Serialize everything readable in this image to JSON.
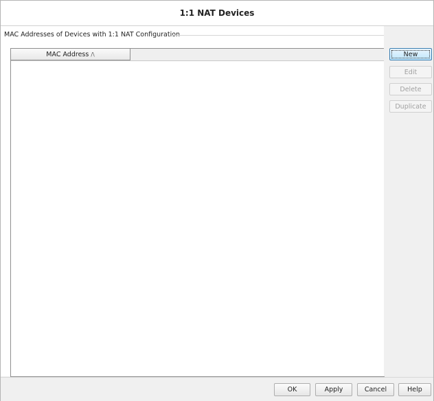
{
  "window": {
    "title": "1:1 NAT Devices"
  },
  "group": {
    "legend": "MAC Addresses of Devices with 1:1 NAT Configuration"
  },
  "table": {
    "columns": [
      {
        "label": "MAC Address",
        "sort": "ascending",
        "sort_glyph": "/\\"
      }
    ],
    "rows": []
  },
  "side_buttons": {
    "new_label": "New",
    "edit_label": "Edit",
    "delete_label": "Delete",
    "duplicate_label": "Duplicate"
  },
  "footer_buttons": {
    "ok_label": "OK",
    "apply_label": "Apply",
    "cancel_label": "Cancel",
    "help_label": "Help"
  },
  "colors": {
    "primary_button_border": "#3c7fb1",
    "primary_button_fill": "#bee6fd",
    "disabled_text": "#a0a0a0"
  }
}
